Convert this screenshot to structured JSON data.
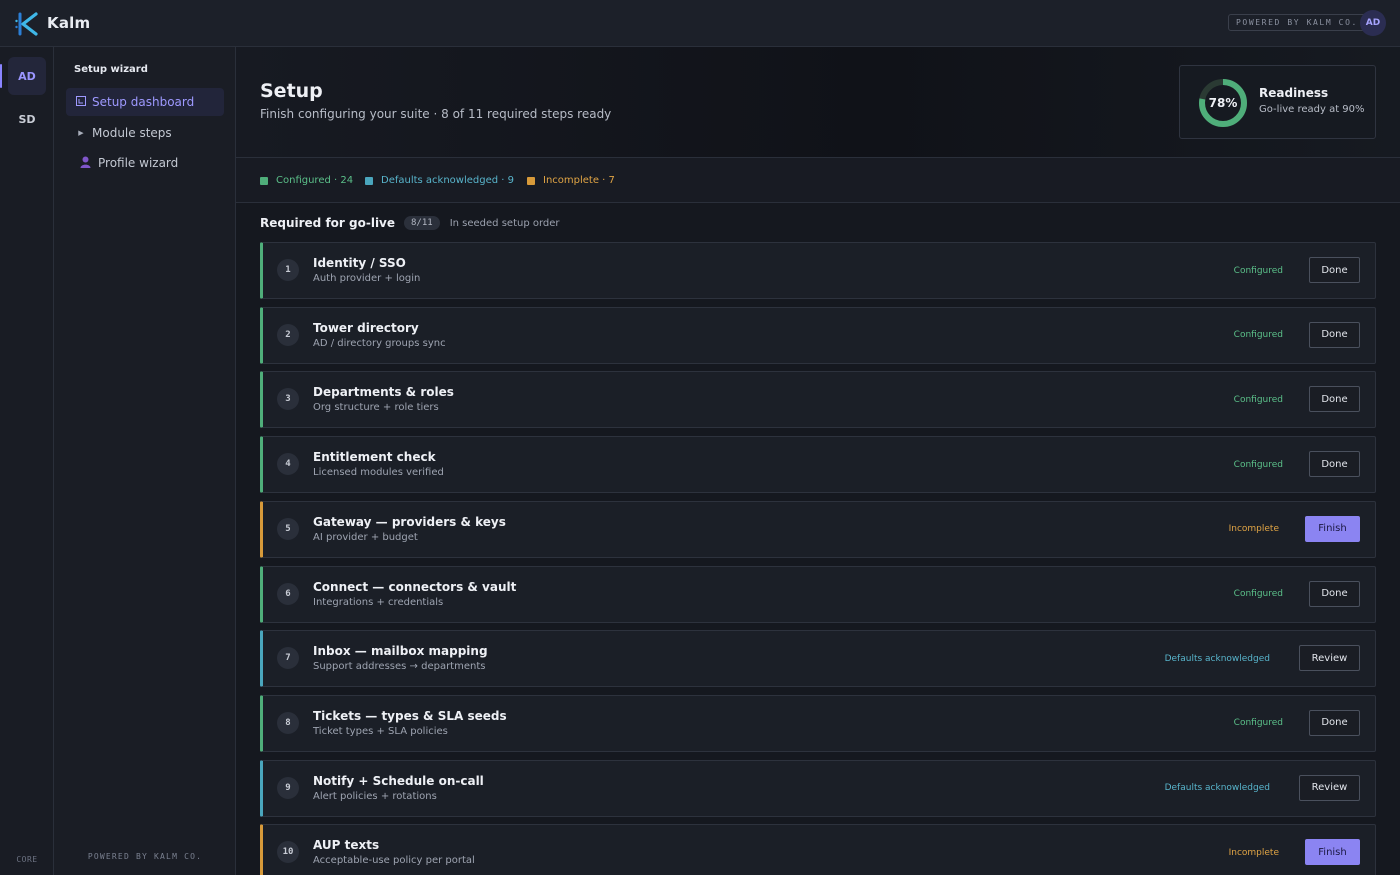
{
  "app": {
    "brand": "Kalm",
    "powered_by": "POWERED BY KALM CO.",
    "user_initials": "AD",
    "accent": "#8a84ff"
  },
  "rail": {
    "items": [
      {
        "label": "AD",
        "active": true
      },
      {
        "label": "SD",
        "active": false
      }
    ],
    "footer": "CORE"
  },
  "sidebar": {
    "title": "Setup wizard",
    "items": [
      {
        "label": "Setup dashboard",
        "icon": "dashboard-icon",
        "active": true
      },
      {
        "label": "Module steps",
        "icon": "caret-right-icon",
        "active": false
      },
      {
        "label": "Profile wizard",
        "icon": "user-icon",
        "active": false
      }
    ],
    "footer": "POWERED BY KALM CO."
  },
  "header": {
    "title": "Setup",
    "subtitle": "Finish configuring your suite · 8 of 11 required steps ready"
  },
  "readiness": {
    "percent_label": "78%",
    "percent": 78,
    "title": "Readiness",
    "subtitle": "Go-live ready at 90%",
    "ring_color": "#4fae7a"
  },
  "legend": {
    "configured": {
      "label": "Configured · 24",
      "color": "#4fae7a"
    },
    "defaults": {
      "label": "Defaults acknowledged · 9",
      "color": "#4aa6bd"
    },
    "incomplete": {
      "label": "Incomplete · 7",
      "color": "#d79a3a"
    }
  },
  "section": {
    "title": "Required for go-live",
    "badge": "8/11",
    "note": "In seeded setup order"
  },
  "steps": [
    {
      "num": "1",
      "title": "Identity / SSO",
      "subtitle": "Auth provider + login",
      "status": "Configured",
      "state": "configured",
      "action": "Done"
    },
    {
      "num": "2",
      "title": "Tower directory",
      "subtitle": "AD / directory groups sync",
      "status": "Configured",
      "state": "configured",
      "action": "Done"
    },
    {
      "num": "3",
      "title": "Departments & roles",
      "subtitle": "Org structure + role tiers",
      "status": "Configured",
      "state": "configured",
      "action": "Done"
    },
    {
      "num": "4",
      "title": "Entitlement check",
      "subtitle": "Licensed modules verified",
      "status": "Configured",
      "state": "configured",
      "action": "Done"
    },
    {
      "num": "5",
      "title": "Gateway — providers & keys",
      "subtitle": "AI provider + budget",
      "status": "Incomplete",
      "state": "incomplete",
      "action": "Finish"
    },
    {
      "num": "6",
      "title": "Connect — connectors & vault",
      "subtitle": "Integrations + credentials",
      "status": "Configured",
      "state": "configured",
      "action": "Done"
    },
    {
      "num": "7",
      "title": "Inbox — mailbox mapping",
      "subtitle": "Support addresses → departments",
      "status": "Defaults acknowledged",
      "state": "defaults",
      "action": "Review"
    },
    {
      "num": "8",
      "title": "Tickets — types & SLA seeds",
      "subtitle": "Ticket types + SLA policies",
      "status": "Configured",
      "state": "configured",
      "action": "Done"
    },
    {
      "num": "9",
      "title": "Notify + Schedule on-call",
      "subtitle": "Alert policies + rotations",
      "status": "Defaults acknowledged",
      "state": "defaults",
      "action": "Review"
    },
    {
      "num": "10",
      "title": "AUP texts",
      "subtitle": "Acceptable-use policy per portal",
      "status": "Incomplete",
      "state": "incomplete",
      "action": "Finish"
    }
  ]
}
